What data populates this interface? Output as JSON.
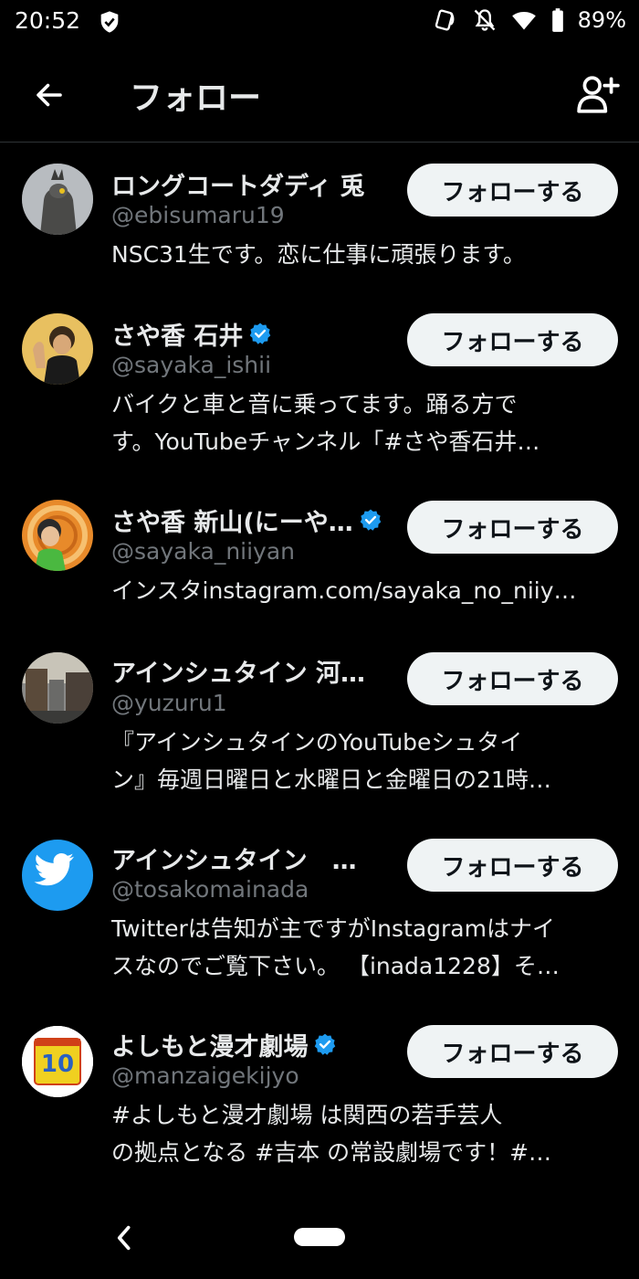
{
  "status_bar": {
    "time": "20:52",
    "battery": "89%"
  },
  "header": {
    "title": "フォロー",
    "back_icon": "arrow-left-icon",
    "add_user_icon": "person-add-icon"
  },
  "users": [
    {
      "name": "ロングコートダディ 兎",
      "handle": "@ebisumaru19",
      "verified": false,
      "bio": [
        "NSC31生です。恋に仕事に頑張ります。"
      ],
      "follow_label": "フォローする"
    },
    {
      "name": "さや香 石井",
      "handle": "@sayaka_ishii",
      "verified": true,
      "bio": [
        "バイクと車と音に乗ってます。踊る方で",
        "す。YouTubeチャンネル「#さや香石井…"
      ],
      "follow_label": "フォローする"
    },
    {
      "name": "さや香 新山(にーや…",
      "handle": "@sayaka_niiyan",
      "verified": true,
      "bio": [
        "インスタinstagram.com/sayaka_no_niiy…"
      ],
      "follow_label": "フォローする"
    },
    {
      "name": "アインシュタイン 河…",
      "handle": "@yuzuru1",
      "verified": false,
      "bio": [
        "『アインシュタインのYouTubeシュタイ",
        "ン』毎週日曜日と水曜日と金曜日の21時…"
      ],
      "follow_label": "フォローする"
    },
    {
      "name": "アインシュタイン　…",
      "handle": "@tosakomainada",
      "verified": false,
      "bio": [
        "Twitterは告知が主ですがInstagramはナイ",
        "スなのでご覧下さい。 【inada1228】そ…"
      ],
      "follow_label": "フォローする"
    },
    {
      "name": "よしもと漫才劇場",
      "handle": "@manzaigekijyo",
      "verified": true,
      "bio": [
        "#よしもと漫才劇場 は関西の若手芸人",
        "の拠点となる #吉本 の常設劇場です！#…"
      ],
      "follow_label": "フォローする"
    }
  ],
  "colors": {
    "background": "#000000",
    "text": "#e7e9ea",
    "secondary": "#71767b",
    "verified": "#1d9bf0",
    "button_bg": "#eff3f4"
  }
}
